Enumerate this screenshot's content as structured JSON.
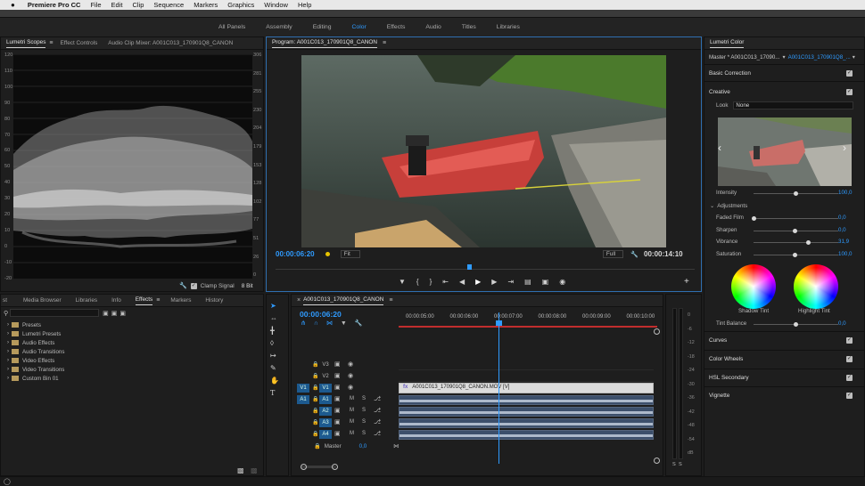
{
  "menubar": {
    "apple": "",
    "app": "Premiere Pro CC",
    "items": [
      "File",
      "Edit",
      "Clip",
      "Sequence",
      "Markers",
      "Graphics",
      "Window",
      "Help"
    ]
  },
  "workspaces": [
    {
      "label": "All Panels",
      "active": false
    },
    {
      "label": "Assembly",
      "active": false
    },
    {
      "label": "Editing",
      "active": false
    },
    {
      "label": "Color",
      "active": true
    },
    {
      "label": "Effects",
      "active": false
    },
    {
      "label": "Audio",
      "active": false
    },
    {
      "label": "Titles",
      "active": false
    },
    {
      "label": "Libraries",
      "active": false
    }
  ],
  "scopes": {
    "tabs": [
      "Lumetri Scopes",
      "Effect Controls",
      "Audio Clip Mixer: A001C013_170901Q8_CANON"
    ],
    "left_scale": [
      "120",
      "110",
      "100",
      "90",
      "80",
      "70",
      "60",
      "50",
      "40",
      "30",
      "20",
      "10",
      "0",
      "-10",
      "-20"
    ],
    "right_scale": [
      "306",
      "281",
      "255",
      "230",
      "204",
      "179",
      "153",
      "128",
      "102",
      "77",
      "51",
      "26",
      "0"
    ],
    "clamp_label": "Clamp Signal",
    "bit_depth": "8 Bit"
  },
  "program": {
    "title": "Program: A001C013_170901Q8_CANON",
    "timecode_in": "00:00:06:20",
    "fit": "Fit",
    "quality": "Full",
    "timecode_out": "00:00:14:10"
  },
  "project": {
    "tabs": [
      "st",
      "Media Browser",
      "Libraries",
      "Info",
      "Effects",
      "Markers",
      "History"
    ],
    "active_tab": "Effects",
    "tree": [
      "Presets",
      "Lumetri Presets",
      "Audio Effects",
      "Audio Transitions",
      "Video Effects",
      "Video Transitions",
      "Custom Bin 01"
    ]
  },
  "timeline": {
    "sequence": "A001C013_170901Q8_CANON",
    "timecode": "00:00:06:20",
    "ruler": [
      "00:00:05:00",
      "00:00:06:00",
      "00:00:07:00",
      "00:00:08:00",
      "00:00:09:00",
      "00:00:10:00"
    ],
    "video_tracks": [
      "V3",
      "V2",
      "V1"
    ],
    "audio_tracks": [
      "A1",
      "A2",
      "A3",
      "A4"
    ],
    "source_v": "V1",
    "source_a": "A1",
    "mute": "M",
    "solo": "S",
    "master_label": "Master",
    "master_value": "0,0",
    "clip_name": "A001C013_170901Q8_CANON.MOV [V]",
    "fx_badge": "fx"
  },
  "meter": {
    "scale": [
      "0",
      "-6",
      "-12",
      "-18",
      "-24",
      "-30",
      "-36",
      "-42",
      "-48",
      "-54",
      "dB"
    ],
    "solo_labels": [
      "S",
      "S"
    ]
  },
  "lumetri": {
    "title": "Lumetri Color",
    "master": "Master * A001C013_17090...",
    "clip": "A001C013_170901Q8_...",
    "basic": "Basic Correction",
    "creative": "Creative",
    "look_label": "Look",
    "look_value": "None",
    "intensity_label": "Intensity",
    "intensity_value": "100,0",
    "adjustments": "Adjustments",
    "params": [
      {
        "label": "Faded Film",
        "value": "0,0",
        "pos": 0.0
      },
      {
        "label": "Sharpen",
        "value": "0,0",
        "pos": 0.5
      },
      {
        "label": "Vibrance",
        "value": "31,9",
        "pos": 0.66
      },
      {
        "label": "Saturation",
        "value": "100,0",
        "pos": 0.5
      }
    ],
    "shadow": "Shadow Tint",
    "highlight": "Highlight Tint",
    "tint_balance": "Tint Balance",
    "tint_value": "0,0",
    "sections": [
      "Curves",
      "Color Wheels",
      "HSL Secondary",
      "Vignette"
    ],
    "accent": "#2f9bff"
  }
}
